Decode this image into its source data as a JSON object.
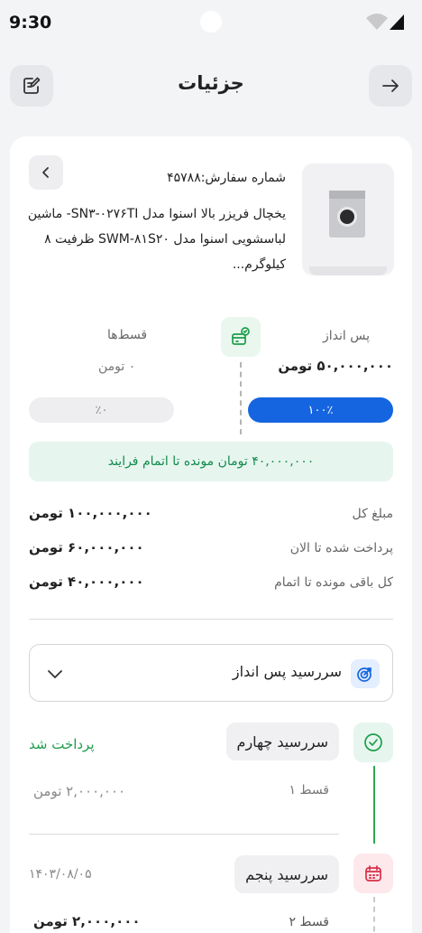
{
  "status_bar": {
    "time": "9:30"
  },
  "header": {
    "title": "جزئیات"
  },
  "order": {
    "number": "شماره سفارش:۴۵۷۸۸",
    "description": "یخچال فریزر بالا اسنوا مدل SN۳-۰۲۷۶TI- ماشین لباسشویی اسنوا مدل SWM-۸۱S۲۰ ظرفیت ۸ کیلوگرم..."
  },
  "savings": {
    "label": "پس انداز",
    "value": "۵۰,۰۰۰,۰۰۰ تومن",
    "percent_label": "۱۰۰٪",
    "percent": 100
  },
  "installments": {
    "label": "قسط‌ها",
    "value": "۰ تومن",
    "percent_label": "٪۰",
    "percent": 0
  },
  "notice": "۴۰,۰۰۰,۰۰۰ تومان مونده تا اتمام فرایند",
  "summary": [
    {
      "label": "مبلغ کل",
      "value": "۱۰۰,۰۰۰,۰۰۰ تومن"
    },
    {
      "label": "پرداخت شده تا الان",
      "value": "۶۰,۰۰۰,۰۰۰ تومن"
    },
    {
      "label": "کل باقی مونده تا اتمام",
      "value": "۴۰,۰۰۰,۰۰۰ تومن"
    }
  ],
  "dropdown": {
    "label": "سررسید پس انداز"
  },
  "timeline": [
    {
      "title": "سررسید چهارم",
      "status": "پرداخت شد",
      "installment": "قسط ۱",
      "amount": "۲,۰۰۰,۰۰۰ تومن",
      "status_color": "#1f9d4c",
      "icon": "check-circle-icon"
    },
    {
      "title": "سررسید پنجم",
      "date": "۱۴۰۳/۰۸/۰۵",
      "installment": "قسط ۲",
      "amount": "۲,۰۰۰,۰۰۰ تومن",
      "icon": "calendar-icon"
    }
  ],
  "colors": {
    "accent_blue": "#1565e0",
    "success_green": "#1f9d4c",
    "notice_bg": "#e6f6ee",
    "danger_soft": "#fde8ec"
  }
}
